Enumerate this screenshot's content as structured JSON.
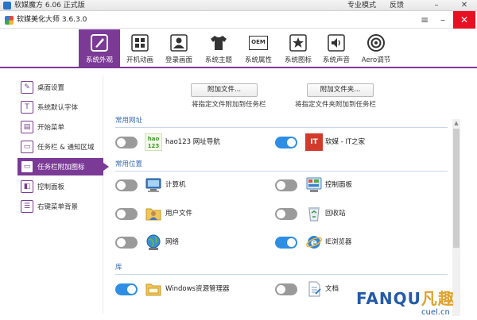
{
  "outer_window": {
    "title": "软媒魔方 6.06 正式版",
    "menu": [
      "专业模式",
      "反馈"
    ],
    "controls": {
      "minimize": "–",
      "close": "✕"
    }
  },
  "inner_window": {
    "title": "软媒美化大师 3.6.3.0",
    "controls": {
      "menu": "≡",
      "minimize": "–",
      "close": "✕"
    }
  },
  "toolbar": {
    "items": [
      {
        "label": "系统外观",
        "icon": "brush-icon",
        "active": true
      },
      {
        "label": "开机动画",
        "icon": "windows-logo-icon",
        "active": false
      },
      {
        "label": "登录画面",
        "icon": "user-frame-icon",
        "active": false
      },
      {
        "label": "系统主题",
        "icon": "tshirt-icon",
        "active": false
      },
      {
        "label": "系统属性",
        "icon": "oem-icon",
        "active": false,
        "badge": "OEM"
      },
      {
        "label": "系统图标",
        "icon": "star-frame-icon",
        "active": false
      },
      {
        "label": "系统声音",
        "icon": "speaker-icon",
        "active": false
      },
      {
        "label": "Aero调节",
        "icon": "target-icon",
        "active": false
      }
    ]
  },
  "sidebar": {
    "items": [
      {
        "label": "桌面设置",
        "icon": "desktop-wrench-icon",
        "active": false
      },
      {
        "label": "系统默认字体",
        "icon": "font-icon",
        "active": false
      },
      {
        "label": "开始菜单",
        "icon": "start-menu-icon",
        "active": false
      },
      {
        "label": "任务栏 & 通知区域",
        "icon": "taskbar-icon",
        "active": false
      },
      {
        "label": "任务栏附加图标",
        "icon": "taskbar-pin-icon",
        "active": true
      },
      {
        "label": "控制面板",
        "icon": "control-panel-icon",
        "active": false
      },
      {
        "label": "右键菜单背景",
        "icon": "context-menu-icon",
        "active": false
      }
    ]
  },
  "actions": {
    "attach_file_button": "附加文件...",
    "attach_file_note": "将指定文件附加到任务栏",
    "attach_folder_button": "附加文件夹...",
    "attach_folder_note": "将指定文件夹附加到任务栏"
  },
  "sections": {
    "common_sites": {
      "title": "常用网址",
      "items": [
        {
          "label": "hao123 网址导航",
          "on": false,
          "icon": "hao123-icon",
          "icon_text": "hao\n123"
        },
        {
          "label": "软媒 - IT之家",
          "on": true,
          "icon": "ithome-icon",
          "icon_text": "IT"
        }
      ]
    },
    "common_places": {
      "title": "常用位置",
      "items": [
        {
          "label": "计算机",
          "on": false,
          "icon": "computer-icon"
        },
        {
          "label": "控制面板",
          "on": false,
          "icon": "control-panel-icon"
        },
        {
          "label": "用户文件",
          "on": false,
          "icon": "user-folder-icon"
        },
        {
          "label": "回收站",
          "on": false,
          "icon": "recycle-bin-icon"
        },
        {
          "label": "网络",
          "on": false,
          "icon": "network-icon"
        },
        {
          "label": "IE浏览器",
          "on": true,
          "icon": "ie-icon"
        }
      ]
    },
    "libraries": {
      "title": "库",
      "items": [
        {
          "label": "Windows资源管理器",
          "on": true,
          "icon": "explorer-folder-icon"
        },
        {
          "label": "文档",
          "on": false,
          "icon": "document-icon"
        }
      ]
    }
  },
  "watermark": {
    "text": "FANQU",
    "logo_text": "凡趣",
    "sub": "cuel.cn"
  },
  "colors": {
    "accent": "#7b3a96",
    "toggle_on": "#2e8ee4",
    "toggle_off": "#9a9a9a",
    "section_title": "#3a6db5"
  }
}
